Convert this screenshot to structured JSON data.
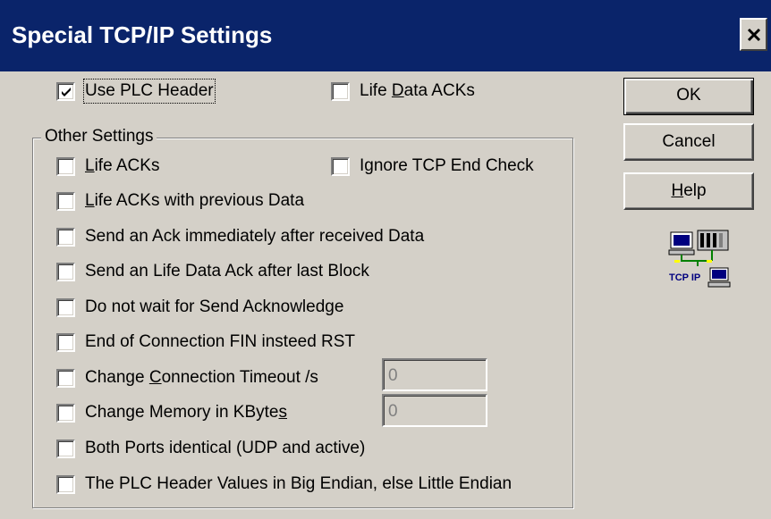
{
  "window": {
    "title": "Special TCP/IP Settings",
    "close_glyph": "×"
  },
  "top_options": {
    "use_plc_header": {
      "label": "Use PLC Header",
      "checked": true
    },
    "life_data_acks": {
      "label_pre": "Life ",
      "label_u": "D",
      "label_post": "ata ACKs",
      "checked": false
    }
  },
  "group": {
    "label": "Other Settings",
    "options": [
      {
        "pre": "",
        "u": "L",
        "post": "ife ACKs",
        "checked": false
      },
      {
        "pre": "",
        "u": "L",
        "post": "ife ACKs with previous Data",
        "checked": false
      },
      {
        "pre": "Send an Ack immediately after received Data",
        "u": "",
        "post": "",
        "checked": false
      },
      {
        "pre": "Send an Life Data Ack after last Block",
        "u": "",
        "post": "",
        "checked": false
      },
      {
        "pre": "Do not wait for Send Acknowledge",
        "u": "",
        "post": "",
        "checked": false
      },
      {
        "pre": "End of Connection FIN insteed RST",
        "u": "",
        "post": "",
        "checked": false
      },
      {
        "pre": "Change ",
        "u": "C",
        "post": "onnection Timeout /s",
        "checked": false
      },
      {
        "pre": "Change Memory in KByte",
        "u": "s",
        "post": "",
        "checked": false
      },
      {
        "pre": "Both Ports identical (UDP and active)",
        "u": "",
        "post": "",
        "checked": false
      },
      {
        "pre": "The PLC Header Values in Big Endian, else Little Endian",
        "u": "",
        "post": "",
        "checked": false
      }
    ],
    "ignore_tcp_end_check": {
      "label": "Ignore TCP End Check",
      "checked": false
    },
    "timeout_value": "0",
    "memory_value": "0"
  },
  "buttons": {
    "ok": "OK",
    "cancel": "Cancel",
    "help_u": "H",
    "help_rest": "elp"
  },
  "icon": {
    "name": "tcp-ip-network-icon",
    "label": "TCP IP"
  }
}
